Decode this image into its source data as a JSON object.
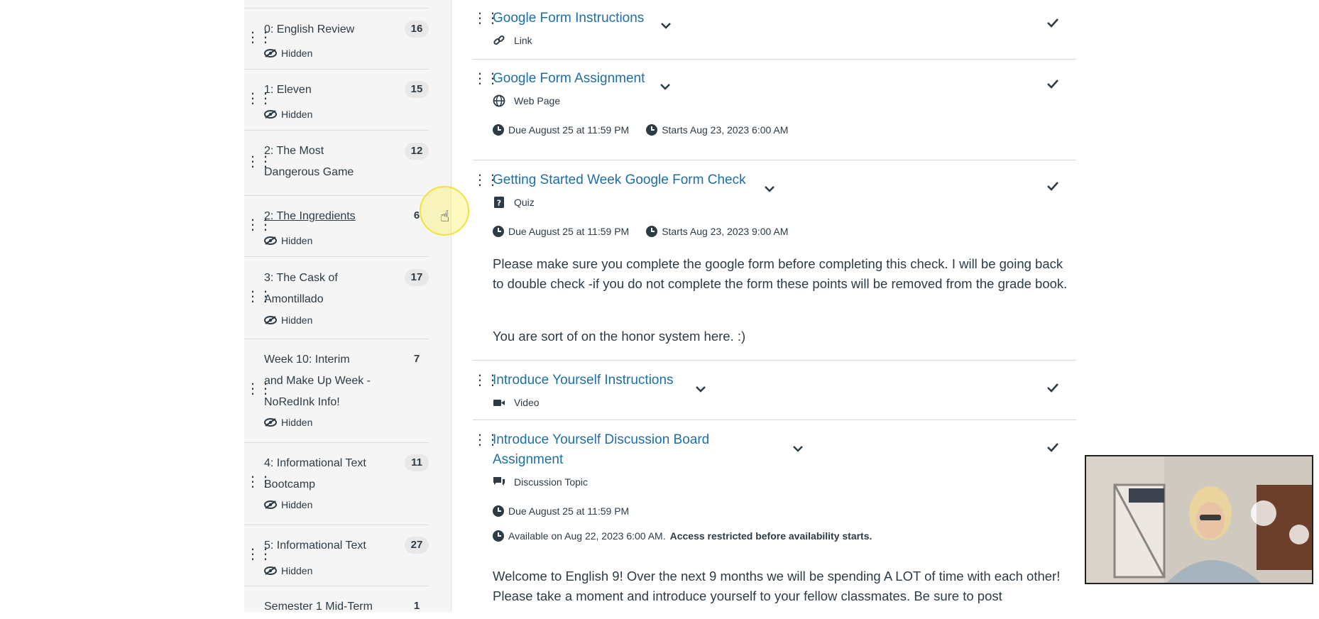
{
  "modules": [
    {
      "title": "0: English Review",
      "count": "16",
      "status": "Hidden"
    },
    {
      "title": "1: Eleven",
      "count": "15",
      "status": "Hidden"
    },
    {
      "title": "2: The Most Dangerous Game",
      "count": "12",
      "status": ""
    },
    {
      "title": "2: The Ingredients",
      "count": "6",
      "status": "Hidden"
    },
    {
      "title": "3: The Cask of Amontillado",
      "count": "17",
      "status": "Hidden"
    },
    {
      "title": "Week 10: Interim and Make Up Week -NoRedInk Info!",
      "count": "7",
      "status": "Hidden"
    },
    {
      "title": "4: Informational Text Bootcamp",
      "count": "11",
      "status": "Hidden"
    },
    {
      "title": "5: Informational Text",
      "count": "27",
      "status": "Hidden"
    },
    {
      "title": "Semester 1 Mid-Term",
      "count": "1",
      "status": ""
    }
  ],
  "items": [
    {
      "title": "Google Form Instructions",
      "type": "Link"
    },
    {
      "title": "Google Form Assignment",
      "type": "Web Page",
      "due": "Due August 25 at 11:59 PM",
      "starts": "Starts Aug 23, 2023 6:00 AM"
    },
    {
      "title": "Getting Started Week Google Form Check",
      "type": "Quiz",
      "due": "Due August 25 at 11:59 PM",
      "starts": "Starts Aug 23, 2023 9:00 AM",
      "desc1": "Please make sure you complete the google form before completing this check.  I will be going back to double check -if you do not complete the form these points will be removed from the grade book.",
      "desc2": "You are sort of on the honor system here. :)"
    },
    {
      "title": "Introduce Yourself Instructions",
      "type": "Video"
    },
    {
      "title": "Introduce Yourself Discussion Board Assignment",
      "type": "Discussion Topic",
      "due": "Due August 25 at 11:59 PM",
      "available": "Available on Aug 22, 2023 6:00 AM.",
      "restricted": "Access restricted before availability starts.",
      "desc": "Welcome to English 9!  Over the next 9 months we will be spending A LOT of time with each other!  Please take a moment and introduce yourself to your fellow classmates.  Be sure to post"
    }
  ],
  "icons": {
    "drag": "drag-handle-icon",
    "hidden": "eye-off-icon",
    "chevron": "chevron-down-icon",
    "check": "checkmark-icon",
    "clock": "clock-icon",
    "link": "link-icon",
    "webpage": "globe-icon",
    "quiz": "quiz-icon",
    "video": "video-icon",
    "discussion": "discussion-icon"
  },
  "colors": {
    "link": "#1d6fa5",
    "text": "#2d3b45"
  }
}
